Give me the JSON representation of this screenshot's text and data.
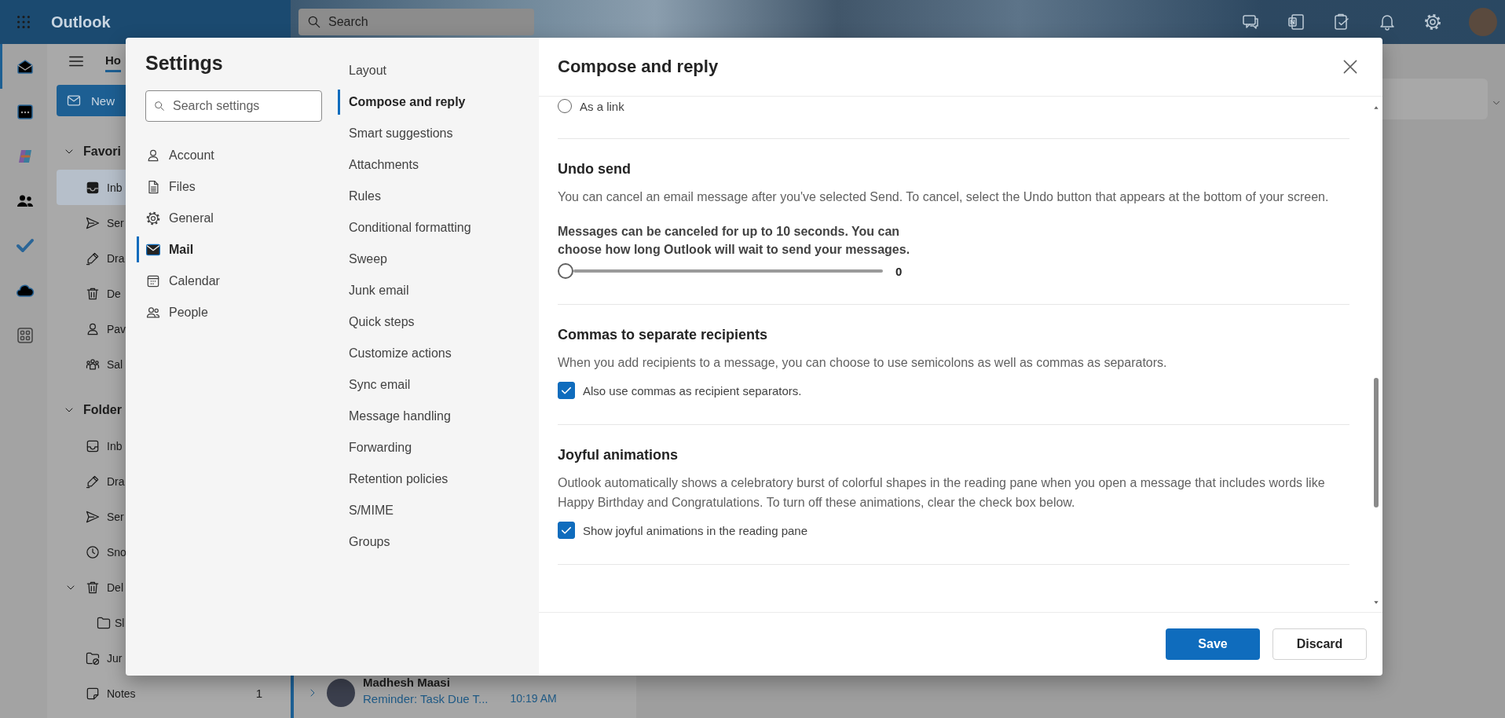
{
  "app_header": {
    "app_name": "Outlook",
    "search": {
      "placeholder": "Search"
    }
  },
  "left_rail": [
    {
      "selected": true
    },
    {
      "selected": false
    },
    {
      "selected": false
    },
    {
      "selected": false
    },
    {
      "selected": false
    },
    {
      "selected": false
    },
    {
      "selected": false
    }
  ],
  "folder_pane": {
    "tab": {
      "label": "Ho",
      "selected": true
    },
    "new_button": "New",
    "sections": [
      {
        "title": "Favori",
        "expanded": true,
        "items": [
          {
            "label": "Inb",
            "selected": true
          },
          {
            "label": "Ser",
            "selected": false
          },
          {
            "label": "Dra",
            "selected": false
          },
          {
            "label": "De",
            "selected": false
          },
          {
            "label": "Pav",
            "selected": false
          },
          {
            "label": "Sal",
            "selected": false
          }
        ]
      },
      {
        "title": "Folder",
        "expanded": true,
        "items": [
          {
            "label": "Inb",
            "selected": false
          },
          {
            "label": "Dra",
            "selected": false
          },
          {
            "label": "Ser",
            "selected": false
          },
          {
            "label": "Sno",
            "selected": false
          },
          {
            "label": "Del",
            "selected": false,
            "expanded": true,
            "children": [
              {
                "label": "Sl",
                "selected": false
              }
            ]
          },
          {
            "label": "Jur",
            "selected": false
          },
          {
            "label": "Notes",
            "selected": false,
            "count": "1"
          }
        ]
      }
    ]
  },
  "message_list": {
    "messages": [
      {
        "sender": "Madhesh Maasi",
        "subject": "Reminder: Task Due T...",
        "time": "10:19 AM",
        "selected": true
      }
    ]
  },
  "settings": {
    "title": "Settings",
    "search": {
      "placeholder": "Search settings"
    },
    "categories": [
      {
        "label": "Account",
        "selected": false
      },
      {
        "label": "Files",
        "selected": false
      },
      {
        "label": "General",
        "selected": false
      },
      {
        "label": "Mail",
        "selected": true
      },
      {
        "label": "Calendar",
        "selected": false
      },
      {
        "label": "People",
        "selected": false
      }
    ],
    "subcategories": [
      {
        "label": "Layout",
        "selected": false
      },
      {
        "label": "Compose and reply",
        "selected": true
      },
      {
        "label": "Smart suggestions",
        "selected": false
      },
      {
        "label": "Attachments",
        "selected": false
      },
      {
        "label": "Rules",
        "selected": false
      },
      {
        "label": "Conditional formatting",
        "selected": false
      },
      {
        "label": "Sweep",
        "selected": false
      },
      {
        "label": "Junk email",
        "selected": false
      },
      {
        "label": "Quick steps",
        "selected": false
      },
      {
        "label": "Customize actions",
        "selected": false
      },
      {
        "label": "Sync email",
        "selected": false
      },
      {
        "label": "Message handling",
        "selected": false
      },
      {
        "label": "Forwarding",
        "selected": false
      },
      {
        "label": "Retention policies",
        "selected": false
      },
      {
        "label": "S/MIME",
        "selected": false
      },
      {
        "label": "Groups",
        "selected": false
      }
    ],
    "page": {
      "title": "Compose and reply",
      "sections": [
        {
          "controls": [
            {
              "kind": "radio",
              "label": "As a link",
              "selected": false
            }
          ]
        },
        {
          "title": "Undo send",
          "description": "You can cancel an email message after you've selected Send. To cancel, select the Undo button that appears at the bottom of your screen.",
          "controls": [
            {
              "kind": "slider",
              "label": "Messages can be canceled for up to 10 seconds. You can choose how long Outlook will wait to send your messages.",
              "level": 0,
              "reading": "0"
            }
          ]
        },
        {
          "title": "Commas to separate recipients",
          "description": "When you add recipients to a message, you can choose to use semicolons as well as commas as separators.",
          "controls": [
            {
              "kind": "checkbox",
              "label": "Also use commas as recipient separators.",
              "checked": true
            }
          ]
        },
        {
          "title": "Joyful animations",
          "description": "Outlook automatically shows a celebratory burst of colorful shapes in the reading pane when you open a message that includes words like Happy Birthday and Congratulations. To turn off these animations, clear the check box below.",
          "controls": [
            {
              "kind": "checkbox",
              "label": "Show joyful animations in the reading pane",
              "checked": true
            }
          ]
        }
      ]
    },
    "buttons": [
      {
        "label": "Save",
        "kind": "primary"
      },
      {
        "label": "Discard",
        "kind": "secondary"
      }
    ]
  }
}
